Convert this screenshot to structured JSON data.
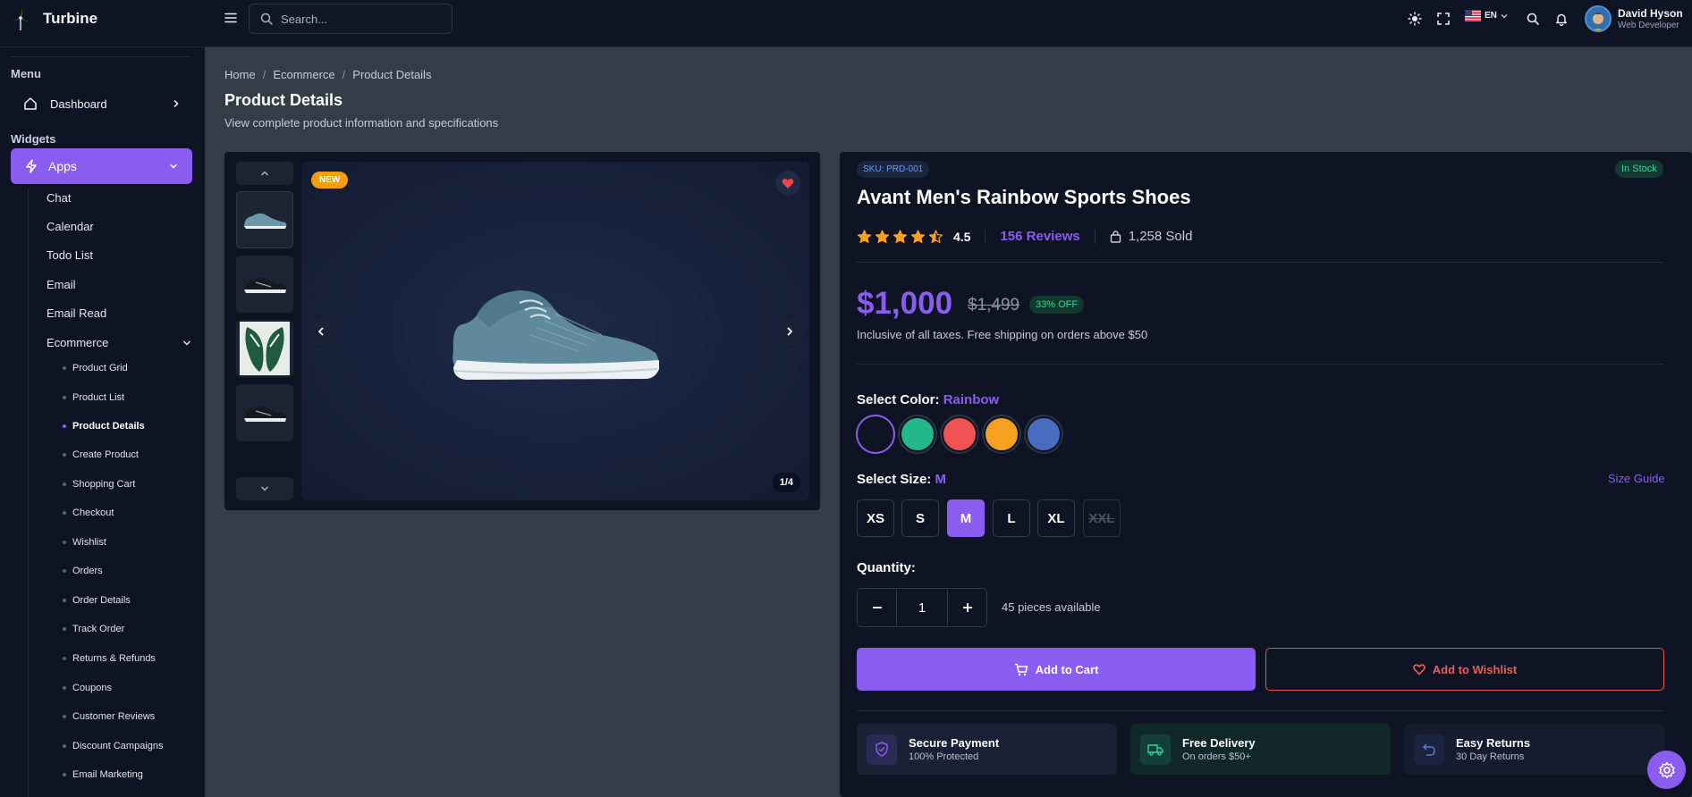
{
  "app": {
    "name": "Turbine"
  },
  "search": {
    "placeholder": "Search..."
  },
  "topbar": {
    "language": "EN"
  },
  "user": {
    "name": "David Hyson",
    "role": "Web Developer"
  },
  "sidebar": {
    "menu_heading": "Menu",
    "dashboard_label": "Dashboard",
    "widgets_heading": "Widgets",
    "apps_label": "Apps",
    "items": [
      "Chat",
      "Calendar",
      "Todo List",
      "Email",
      "Email Read",
      "Ecommerce"
    ],
    "ecommerce_items": [
      "Product Grid",
      "Product List",
      "Product Details",
      "Create Product",
      "Shopping Cart",
      "Checkout",
      "Wishlist",
      "Orders",
      "Order Details",
      "Track Order",
      "Returns & Refunds",
      "Coupons",
      "Customer Reviews",
      "Discount Campaigns",
      "Email Marketing"
    ],
    "active_item": "Product Details"
  },
  "breadcrumb": [
    "Home",
    "Ecommerce",
    "Product Details"
  ],
  "page": {
    "title": "Product Details",
    "subtitle": "View complete product information and specifications"
  },
  "gallery": {
    "badge": "NEW",
    "counter": "1/4"
  },
  "product": {
    "sku": "SKU: PRD-001",
    "stock": "In Stock",
    "title": "Avant Men's Rainbow Sports Shoes",
    "rating": "4.5",
    "rating_stars": 4.5,
    "reviews": "156 Reviews",
    "sold": "1,258 Sold",
    "price": "$1,000",
    "old_price": "$1,499",
    "discount": "33% OFF",
    "tax_note": "Inclusive of all taxes. Free shipping on orders above $50",
    "color_label": "Select Color:",
    "color_value": "Rainbow",
    "colors": [
      "#0e1424",
      "#22b88a",
      "#f05252",
      "#f5a020",
      "#4a6cc0"
    ],
    "size_label": "Select Size:",
    "size_value": "M",
    "size_guide": "Size Guide",
    "sizes": [
      "XS",
      "S",
      "M",
      "L",
      "XL",
      "XXL"
    ],
    "quantity_label": "Quantity:",
    "quantity": "1",
    "available": "45 pieces available",
    "add_to_cart": "Add to Cart",
    "add_to_wishlist": "Add to Wishlist"
  },
  "features": [
    {
      "title": "Secure Payment",
      "subtitle": "100% Protected"
    },
    {
      "title": "Free Delivery",
      "subtitle": "On orders $50+"
    },
    {
      "title": "Easy Returns",
      "subtitle": "30 Day Returns"
    }
  ],
  "colors": {
    "accent": "#8a5cf0",
    "success": "#34d399",
    "danger": "#f05a5a",
    "warning": "#f59e0b"
  }
}
